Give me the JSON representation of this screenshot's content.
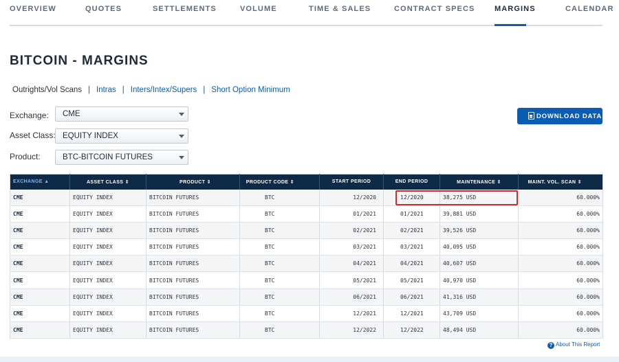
{
  "nav": {
    "tabs": [
      {
        "label": "OVERVIEW"
      },
      {
        "label": "QUOTES"
      },
      {
        "label": "SETTLEMENTS"
      },
      {
        "label": "VOLUME"
      },
      {
        "label": "TIME & SALES"
      },
      {
        "label": "CONTRACT SPECS"
      },
      {
        "label": "MARGINS"
      },
      {
        "label": "CALENDAR"
      }
    ],
    "active_tab": "MARGINS"
  },
  "page": {
    "title": "BITCOIN - MARGINS"
  },
  "subnav": {
    "items": [
      {
        "label": "Outrights/Vol Scans"
      },
      {
        "label": "Intras"
      },
      {
        "label": "Inters/Intex/Supers"
      },
      {
        "label": "Short Option Minimum"
      }
    ],
    "separator": "|"
  },
  "filters": {
    "exchange": {
      "label": "Exchange:",
      "value": "CME"
    },
    "asset_class": {
      "label": "Asset Class:",
      "value": "EQUITY INDEX"
    },
    "product": {
      "label": "Product:",
      "value": "BTC-BITCOIN FUTURES"
    }
  },
  "download": {
    "label": "DOWNLOAD DATA"
  },
  "table": {
    "headers": [
      {
        "label": "EXCHANGE",
        "sort": "▲"
      },
      {
        "label": "ASSET CLASS",
        "sort": "⇕"
      },
      {
        "label": "PRODUCT",
        "sort": "⇕"
      },
      {
        "label": "PRODUCT CODE",
        "sort": "⇕"
      },
      {
        "label": "START PERIOD",
        "sort": ""
      },
      {
        "label": "END PERIOD",
        "sort": ""
      },
      {
        "label": "MAINTENANCE",
        "sort": "⇕"
      },
      {
        "label": "MAINT. VOL. SCAN",
        "sort": "⇕"
      }
    ],
    "rows": [
      {
        "exchange": "CME",
        "asset_class": "EQUITY INDEX",
        "product": "BITCOIN FUTURES",
        "product_code": "BTC",
        "start_period": "12/2020",
        "end_period": "12/2020",
        "maintenance": "38,275 USD",
        "scan": "60.000%"
      },
      {
        "exchange": "CME",
        "asset_class": "EQUITY INDEX",
        "product": "BITCOIN FUTURES",
        "product_code": "BTC",
        "start_period": "01/2021",
        "end_period": "01/2021",
        "maintenance": "39,881 USD",
        "scan": "60.000%"
      },
      {
        "exchange": "CME",
        "asset_class": "EQUITY INDEX",
        "product": "BITCOIN FUTURES",
        "product_code": "BTC",
        "start_period": "02/2021",
        "end_period": "02/2021",
        "maintenance": "39,526 USD",
        "scan": "60.000%"
      },
      {
        "exchange": "CME",
        "asset_class": "EQUITY INDEX",
        "product": "BITCOIN FUTURES",
        "product_code": "BTC",
        "start_period": "03/2021",
        "end_period": "03/2021",
        "maintenance": "40,095 USD",
        "scan": "60.000%"
      },
      {
        "exchange": "CME",
        "asset_class": "EQUITY INDEX",
        "product": "BITCOIN FUTURES",
        "product_code": "BTC",
        "start_period": "04/2021",
        "end_period": "04/2021",
        "maintenance": "40,607 USD",
        "scan": "60.000%"
      },
      {
        "exchange": "CME",
        "asset_class": "EQUITY INDEX",
        "product": "BITCOIN FUTURES",
        "product_code": "BTC",
        "start_period": "05/2021",
        "end_period": "05/2021",
        "maintenance": "40,970 USD",
        "scan": "60.000%"
      },
      {
        "exchange": "CME",
        "asset_class": "EQUITY INDEX",
        "product": "BITCOIN FUTURES",
        "product_code": "BTC",
        "start_period": "06/2021",
        "end_period": "06/2021",
        "maintenance": "41,316 USD",
        "scan": "60.000%"
      },
      {
        "exchange": "CME",
        "asset_class": "EQUITY INDEX",
        "product": "BITCOIN FUTURES",
        "product_code": "BTC",
        "start_period": "12/2021",
        "end_period": "12/2021",
        "maintenance": "43,709 USD",
        "scan": "60.000%"
      },
      {
        "exchange": "CME",
        "asset_class": "EQUITY INDEX",
        "product": "BITCOIN FUTURES",
        "product_code": "BTC",
        "start_period": "12/2022",
        "end_period": "12/2022",
        "maintenance": "48,494 USD",
        "scan": "60.000%"
      }
    ]
  },
  "about": {
    "label": "About This Report",
    "icon": "?"
  },
  "colors": {
    "accent": "#0b5db3",
    "table_header": "#0e2a47",
    "highlight": "#c9302c"
  }
}
